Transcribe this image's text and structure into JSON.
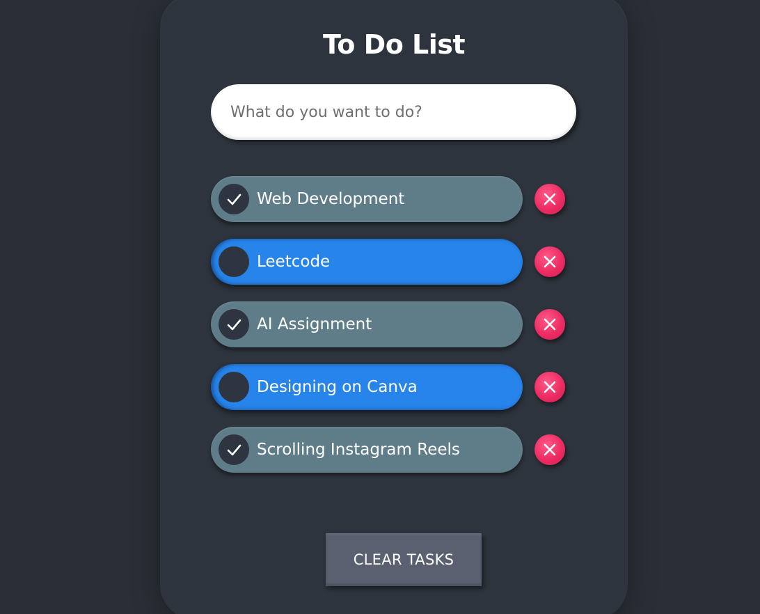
{
  "app": {
    "title": "To Do List"
  },
  "input": {
    "placeholder": "What do you want to do?",
    "value": ""
  },
  "tasks": [
    {
      "label": "Web Development",
      "completed": true
    },
    {
      "label": "Leetcode",
      "completed": false
    },
    {
      "label": "AI Assignment",
      "completed": true
    },
    {
      "label": "Designing on Canva",
      "completed": false
    },
    {
      "label": "Scrolling Instagram Reels",
      "completed": true
    }
  ],
  "icons": {
    "check": "check-icon",
    "delete": "close-icon"
  },
  "colors": {
    "background": "#2a2f37",
    "card": "#2e343d",
    "task_completed": "#5f7d88",
    "task_pending": "#2784ea",
    "delete_button": "#ec2c62",
    "clear_button": "#5a6070"
  },
  "actions": {
    "clear_label": "CLEAR TASKS"
  }
}
